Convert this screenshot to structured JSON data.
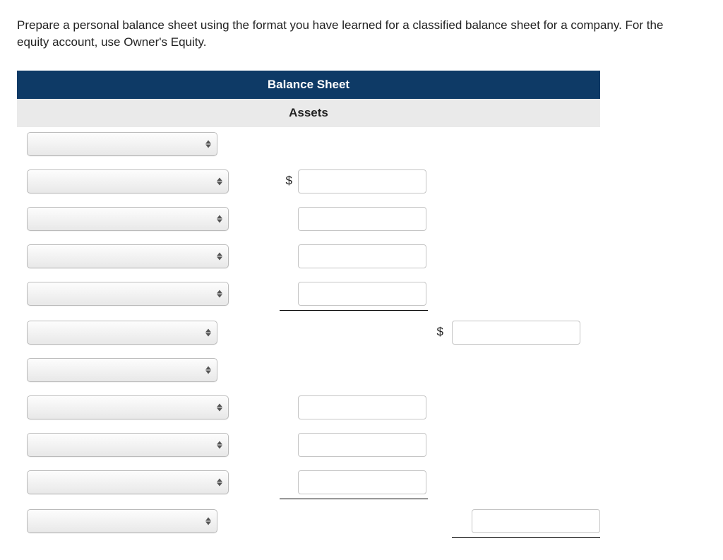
{
  "instructions": "Prepare a personal balance sheet using the format you have learned for a classified balance sheet for a company. For the equity account, use Owner's Equity.",
  "title": "Balance Sheet",
  "section_assets": "Assets",
  "currency_symbol": "$",
  "rows": [
    {
      "select": "",
      "indent": false,
      "amount1": null,
      "currency1": false,
      "amount2": null,
      "currency2": false,
      "underline1": false,
      "underline2": false
    },
    {
      "select": "",
      "indent": true,
      "amount1": "",
      "currency1": true,
      "amount2": null,
      "currency2": false,
      "underline1": false,
      "underline2": false
    },
    {
      "select": "",
      "indent": true,
      "amount1": "",
      "currency1": false,
      "amount2": null,
      "currency2": false,
      "underline1": false,
      "underline2": false
    },
    {
      "select": "",
      "indent": true,
      "amount1": "",
      "currency1": false,
      "amount2": null,
      "currency2": false,
      "underline1": false,
      "underline2": false
    },
    {
      "select": "",
      "indent": true,
      "amount1": "",
      "currency1": false,
      "amount2": null,
      "currency2": false,
      "underline1": true,
      "underline2": false
    },
    {
      "select": "",
      "indent": false,
      "amount1": null,
      "currency1": false,
      "amount2": "",
      "currency2": true,
      "underline1": false,
      "underline2": false
    },
    {
      "select": "",
      "indent": false,
      "amount1": null,
      "currency1": false,
      "amount2": null,
      "currency2": false,
      "underline1": false,
      "underline2": false
    },
    {
      "select": "",
      "indent": true,
      "amount1": "",
      "currency1": false,
      "amount2": null,
      "currency2": false,
      "underline1": false,
      "underline2": false
    },
    {
      "select": "",
      "indent": true,
      "amount1": "",
      "currency1": false,
      "amount2": null,
      "currency2": false,
      "underline1": false,
      "underline2": false
    },
    {
      "select": "",
      "indent": true,
      "amount1": "",
      "currency1": false,
      "amount2": null,
      "currency2": false,
      "underline1": true,
      "underline2": false
    },
    {
      "select": "",
      "indent": false,
      "amount1": null,
      "currency1": false,
      "amount2": "",
      "currency2": false,
      "underline1": false,
      "underline2": true
    }
  ]
}
